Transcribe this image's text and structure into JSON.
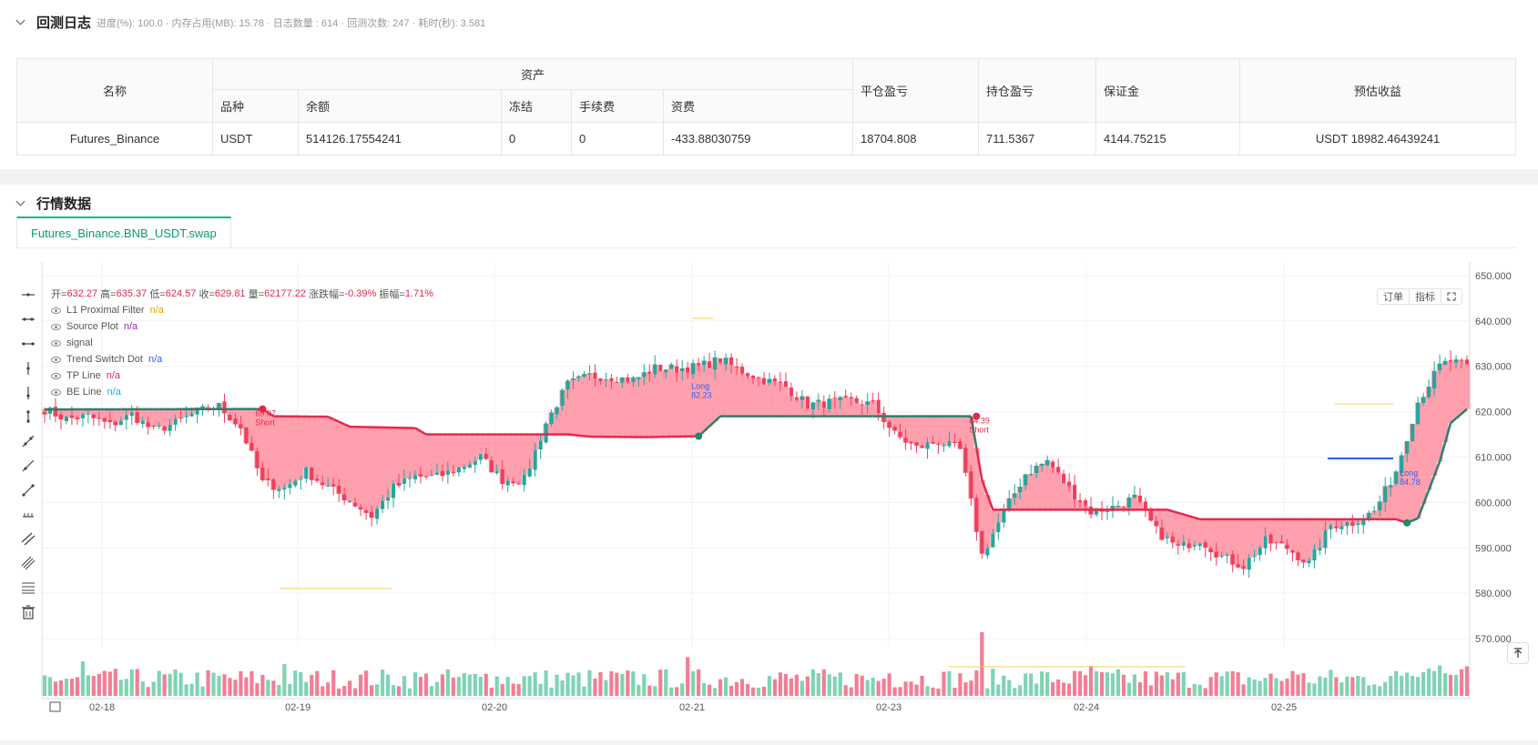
{
  "log": {
    "title": "回测日志",
    "stats": "进度(%): 100.0 · 内存占用(MB): 15.78 · 日志数量 : 614 · 回测次数: 247 · 耗时(秒): 3.581"
  },
  "assets_table": {
    "headers": {
      "name": "名称",
      "assets": "资产",
      "symbol": "品种",
      "balance": "余额",
      "frozen": "冻结",
      "fee": "手续费",
      "funding": "资费",
      "close_pnl": "平仓盈亏",
      "position_pnl": "持仓盈亏",
      "margin": "保证金",
      "est_profit": "预估收益"
    },
    "row": {
      "name": "Futures_Binance",
      "symbol": "USDT",
      "balance": "514126.17554241",
      "frozen": "0",
      "fee": "0",
      "funding": "-433.88030759",
      "close_pnl": "18704.808",
      "position_pnl": "711.5367",
      "margin": "4144.75215",
      "est_profit": "USDT 18982.46439241"
    }
  },
  "market": {
    "title": "行情数据",
    "tab": "Futures_Binance.BNB_USDT.swap"
  },
  "ohlc": {
    "open_label": "开=",
    "open": "632.27",
    "high_label": "高=",
    "high": "635.37",
    "low_label": "低=",
    "low": "624.57",
    "close_label": "收=",
    "close": "629.81",
    "vol_label": "量=",
    "vol": "62177.22",
    "chg_label": "涨跌幅=",
    "chg": "-0.39%",
    "amp_label": "振幅=",
    "amp": "1.71%"
  },
  "legend": [
    {
      "name": "L1 Proximal Filter",
      "value": "n/a",
      "color": "#e3a008"
    },
    {
      "name": "Source Plot",
      "value": "n/a",
      "color": "#9c27b0"
    },
    {
      "name": "signal",
      "value": "",
      "color": "#555555"
    },
    {
      "name": "Trend Switch Dot",
      "value": "n/a",
      "color": "#2962ff"
    },
    {
      "name": "TP Line",
      "value": "n/a",
      "color": "#e0294a"
    },
    {
      "name": "BE Line",
      "value": "n/a",
      "color": "#00bcd4"
    }
  ],
  "chart_buttons": {
    "order": "订单",
    "indicator": "指标"
  },
  "chart_data": {
    "type": "candlestick",
    "y_ticks": [
      "650.000",
      "640.000",
      "630.000",
      "620.000",
      "610.000",
      "600.000",
      "590.000",
      "580.000",
      "570.000"
    ],
    "ylim": [
      568,
      653
    ],
    "x_ticks": [
      "02-18",
      "02-19",
      "02-20",
      "02-21",
      "02-23",
      "02-24",
      "02-25"
    ],
    "colors": {
      "up": "#26a69a",
      "down": "#ef3f5c",
      "fill": "#ff8fa0",
      "vol_up": "#7fd3b4",
      "vol_down": "#f27e94"
    },
    "close_path": [
      [
        0,
        620.5
      ],
      [
        4,
        618.4
      ],
      [
        8,
        619.0
      ],
      [
        12,
        617.0
      ],
      [
        16,
        619.4
      ],
      [
        20,
        615.8
      ],
      [
        24,
        617.5
      ],
      [
        28,
        620.0
      ],
      [
        32,
        621.2
      ],
      [
        36,
        616.5
      ],
      [
        40,
        604.4
      ],
      [
        44,
        603.1
      ],
      [
        48,
        606.8
      ],
      [
        52,
        603.3
      ],
      [
        56,
        600.5
      ],
      [
        60,
        597.0
      ],
      [
        64,
        603.2
      ],
      [
        68,
        605.7
      ],
      [
        72,
        605.6
      ],
      [
        76,
        607.5
      ],
      [
        80,
        610.0
      ],
      [
        84,
        605.0
      ],
      [
        88,
        605.0
      ],
      [
        92,
        617.5
      ],
      [
        96,
        626.0
      ],
      [
        100,
        627.9
      ],
      [
        104,
        627.6
      ],
      [
        108,
        627.0
      ],
      [
        112,
        629.6
      ],
      [
        116,
        629.5
      ],
      [
        120,
        629.9
      ],
      [
        124,
        631.5
      ],
      [
        128,
        628.9
      ],
      [
        132,
        627.0
      ],
      [
        136,
        625.5
      ],
      [
        140,
        621.5
      ],
      [
        144,
        622.0
      ],
      [
        148,
        622.3
      ],
      [
        152,
        621.6
      ],
      [
        156,
        615.0
      ],
      [
        160,
        612.0
      ],
      [
        164,
        613.5
      ],
      [
        168,
        611.5
      ],
      [
        172,
        588.4
      ],
      [
        176,
        597.8
      ],
      [
        180,
        606.3
      ],
      [
        184,
        609.2
      ],
      [
        188,
        603.0
      ],
      [
        192,
        598.0
      ],
      [
        196,
        598.9
      ],
      [
        200,
        601.0
      ],
      [
        204,
        593.8
      ],
      [
        208,
        590.0
      ],
      [
        212,
        591.9
      ],
      [
        216,
        588.0
      ],
      [
        220,
        586.0
      ],
      [
        224,
        591.5
      ],
      [
        228,
        590.0
      ],
      [
        232,
        586.5
      ],
      [
        236,
        595.0
      ],
      [
        240,
        595.6
      ],
      [
        244,
        598.0
      ],
      [
        248,
        607.0
      ],
      [
        252,
        622.2
      ],
      [
        256,
        630.0
      ],
      [
        258,
        631.2
      ],
      [
        261,
        629.8
      ]
    ],
    "filter_line": [
      [
        0,
        620.5
      ],
      [
        40,
        620.6
      ],
      [
        42,
        619.0
      ],
      [
        52,
        618.9
      ],
      [
        56,
        616.7
      ],
      [
        68,
        616.4
      ],
      [
        70,
        615.0
      ],
      [
        96,
        615.0
      ],
      [
        100,
        614.5
      ],
      [
        110,
        614.4
      ],
      [
        120,
        614.6
      ],
      [
        124,
        619.0
      ],
      [
        170,
        619.0
      ],
      [
        172,
        605.0
      ],
      [
        174,
        598.4
      ],
      [
        206,
        598.4
      ],
      [
        212,
        596.3
      ],
      [
        248,
        596.3
      ],
      [
        250,
        595.5
      ],
      [
        252,
        596.5
      ],
      [
        256,
        609.0
      ],
      [
        258,
        617.5
      ],
      [
        261,
        620.6
      ]
    ],
    "signals": [
      {
        "label": "Short",
        "value": "69.07",
        "index": 40,
        "price": 620.6,
        "side": "short"
      },
      {
        "label": "Long",
        "value": "82.23",
        "index": 120,
        "price": 614.6,
        "side": "long"
      },
      {
        "label": "Short",
        "value": "84.39",
        "index": 171,
        "price": 619.0,
        "side": "short"
      },
      {
        "label": "Long",
        "value": "84.78",
        "index": 250,
        "price": 595.5,
        "side": "long"
      }
    ]
  }
}
